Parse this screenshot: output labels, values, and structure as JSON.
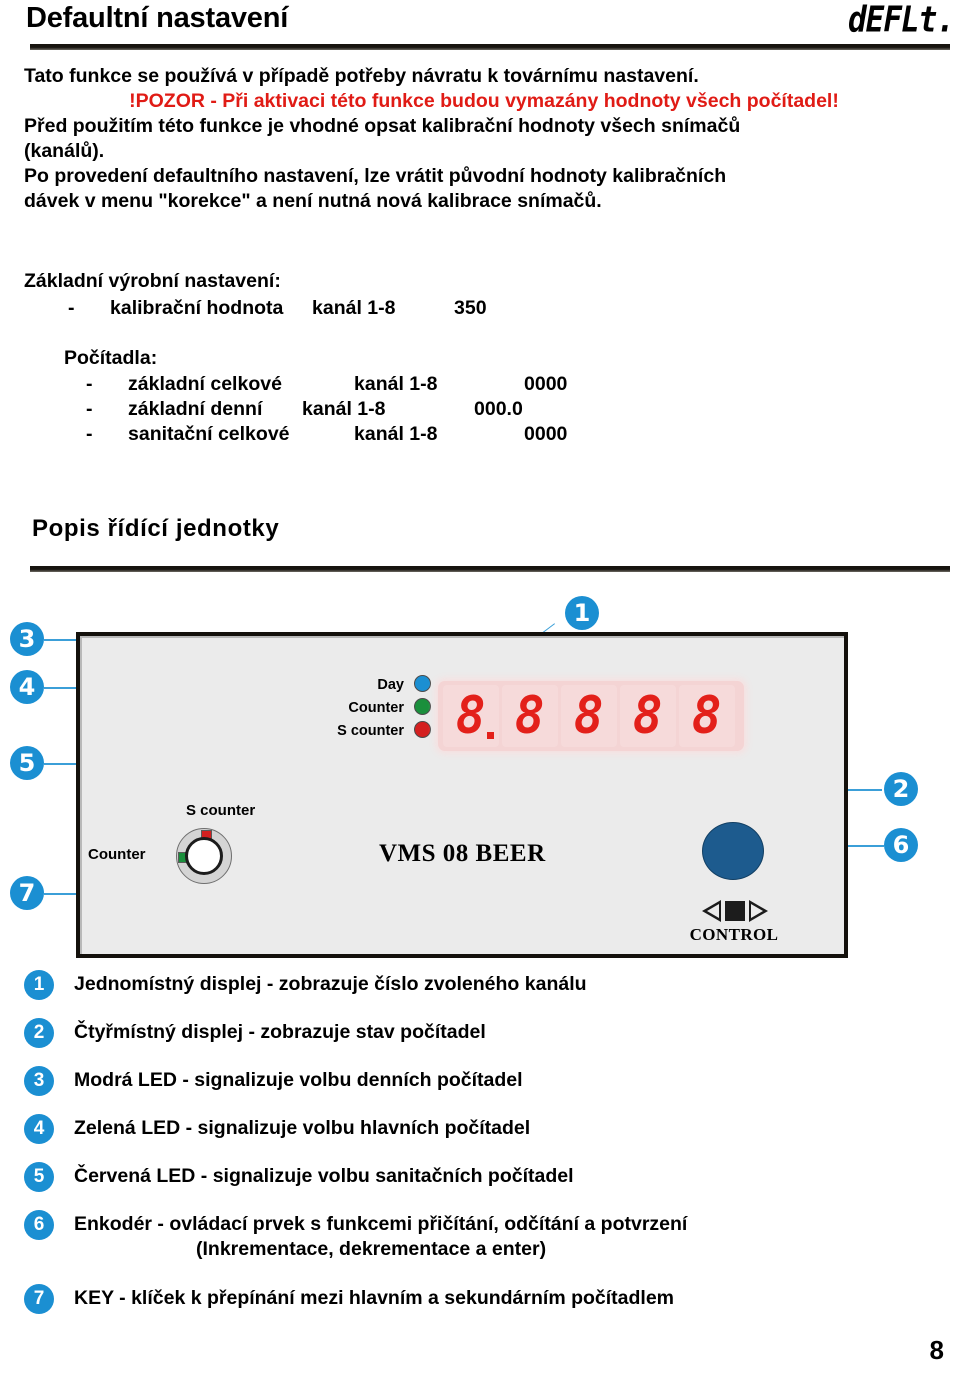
{
  "header": {
    "title": "Defaultní nastavení",
    "logo": "dEFLt."
  },
  "intro": {
    "line1": "Tato funkce se používá v případě potřeby návratu k továrnímu nastavení.",
    "warning": "!POZOR - Při aktivaci této funkce budou vymazány hodnoty všech počítadel!",
    "line2": "Před použitím této funkce je vhodné opsat kalibrační hodnoty všech snímačů",
    "line3": "(kanálů).",
    "line4": "Po provedení defaultního nastavení, lze vrátit původní hodnoty kalibračních",
    "line5": "dávek v menu \"korekce\" a není nutná nová kalibrace snímačů."
  },
  "settings": {
    "heading": "Základní výrobní nastavení:",
    "calibration": {
      "dash": "-",
      "name": "kalibrační hodnota",
      "channel": "kanál 1-8",
      "value": "350"
    },
    "counters_heading": "Počítadla:",
    "counters": [
      {
        "dash": "-",
        "name": "základní celkové",
        "channel": "kanál 1-8",
        "value": "0000"
      },
      {
        "dash": "-",
        "name": "základní denní",
        "channel": "kanál 1-8",
        "value": "000.0"
      },
      {
        "dash": "-",
        "name": "sanitační celkové",
        "channel": "kanál 1-8",
        "value": "0000"
      }
    ]
  },
  "section": {
    "title": "Popis řídící jednotky"
  },
  "device": {
    "brand": "VMS 08 BEER",
    "display": {
      "digits": [
        "8",
        "8",
        "8",
        "8",
        "8"
      ],
      "decimal_after_digit": 1,
      "color": "#e3201a",
      "panel_color": "#f4d4d4"
    },
    "leds": [
      {
        "label": "Day",
        "color": "#1b8fd2"
      },
      {
        "label": "Counter",
        "color": "#1a8f3c"
      },
      {
        "label": "S counter",
        "color": "#d42020"
      }
    ],
    "key_switch": {
      "label_top": "S counter",
      "label_left": "Counter",
      "marker_top_color": "#d42020",
      "marker_left_color": "#1a8f3c"
    },
    "encoder": {
      "caption": "CONTROL",
      "knob_color": "#1d5b8e",
      "icons": [
        "left-triangle",
        "stop-square",
        "right-triangle"
      ]
    },
    "callouts": [
      "1",
      "2",
      "3",
      "4",
      "5",
      "6",
      "7"
    ]
  },
  "legend": [
    {
      "num": "1",
      "text": "Jednomístný displej - zobrazuje číslo zvoleného kanálu",
      "sub": ""
    },
    {
      "num": "2",
      "text": "Čtyřmístný displej - zobrazuje stav počítadel",
      "sub": ""
    },
    {
      "num": "3",
      "text": "Modrá LED - signalizuje volbu denních počítadel",
      "sub": ""
    },
    {
      "num": "4",
      "text": "Zelená LED - signalizuje volbu hlavních počítadel",
      "sub": ""
    },
    {
      "num": "5",
      "text": "Červená LED - signalizuje volbu sanitačních počítadel",
      "sub": ""
    },
    {
      "num": "6",
      "text": "Enkodér - ovládací prvek s funkcemi přičítání, odčítání a potvrzení",
      "sub": "(Inkrementace, dekrementace a enter)"
    },
    {
      "num": "7",
      "text": "KEY - klíček k přepínání mezi hlavním a sekundárním počítadlem",
      "sub": ""
    }
  ],
  "footer": {
    "page_number": "8"
  },
  "colors": {
    "accent": "#1b8fd2",
    "warning": "#e01b15",
    "panel": "#ebebeb",
    "rule": "#17140f"
  }
}
